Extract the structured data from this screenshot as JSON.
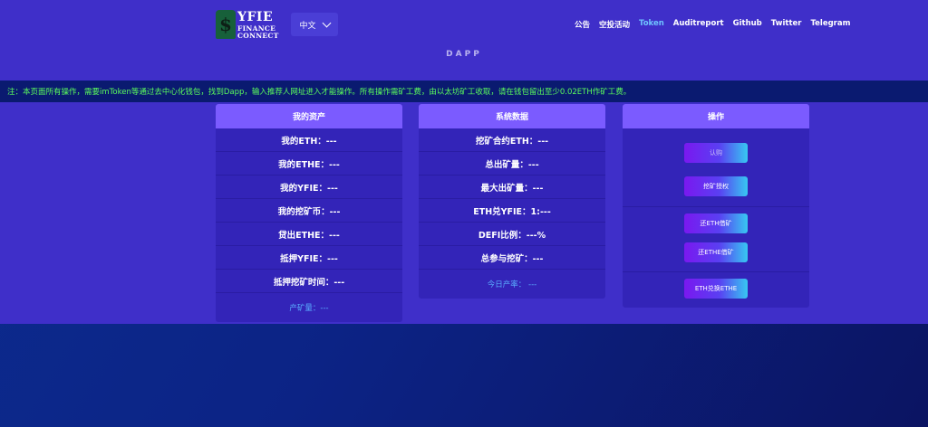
{
  "brand": {
    "line1": "YFIE",
    "line2": "FINANCE",
    "line3": "CONNECT",
    "glyph": "$"
  },
  "lang": {
    "label": "中文"
  },
  "nav": [
    "公告",
    "空投活动",
    "Token",
    "Auditreport",
    "Github",
    "Twitter",
    "Telegram"
  ],
  "nav_active_index": 2,
  "page_title": "DAPP",
  "notice": "注：本页面所有操作，需要imToken等通过去中心化钱包，找到Dapp，输入推荐人网址进入才能操作。所有操作需矿工费，由以太坊矿工收取，请在钱包留出至少0.02ETH作矿工费。",
  "assets": {
    "title": "我的资产",
    "rows": [
      "我的ETH：---",
      "我的ETHE：---",
      "我的YFIE：---",
      "我的挖矿币：---",
      "贷出ETHE：---",
      "抵押YFIE：---",
      "抵押挖矿时间：---"
    ],
    "footer": "产矿量：---"
  },
  "system": {
    "title": "系统数据",
    "rows": [
      "挖矿合约ETH：---",
      "总出矿量：---",
      "最大出矿量：---",
      "ETH兑YFIE：1:---",
      "DEFI比例：---%",
      "总参与挖矿：---"
    ],
    "footer": "今日产率： ---"
  },
  "ops": {
    "title": "操作",
    "buttons": [
      "认购",
      "挖矿授权",
      "还ETH借矿",
      "还ETHE借矿",
      "ETH兑换ETHE"
    ]
  },
  "colors": {
    "header_bg": "#3f2fc9",
    "panel_head": "#7b5bff",
    "notice_text": "#5cff5c",
    "nav_active": "#6fc3ff",
    "footer_link": "#5aaeff"
  }
}
